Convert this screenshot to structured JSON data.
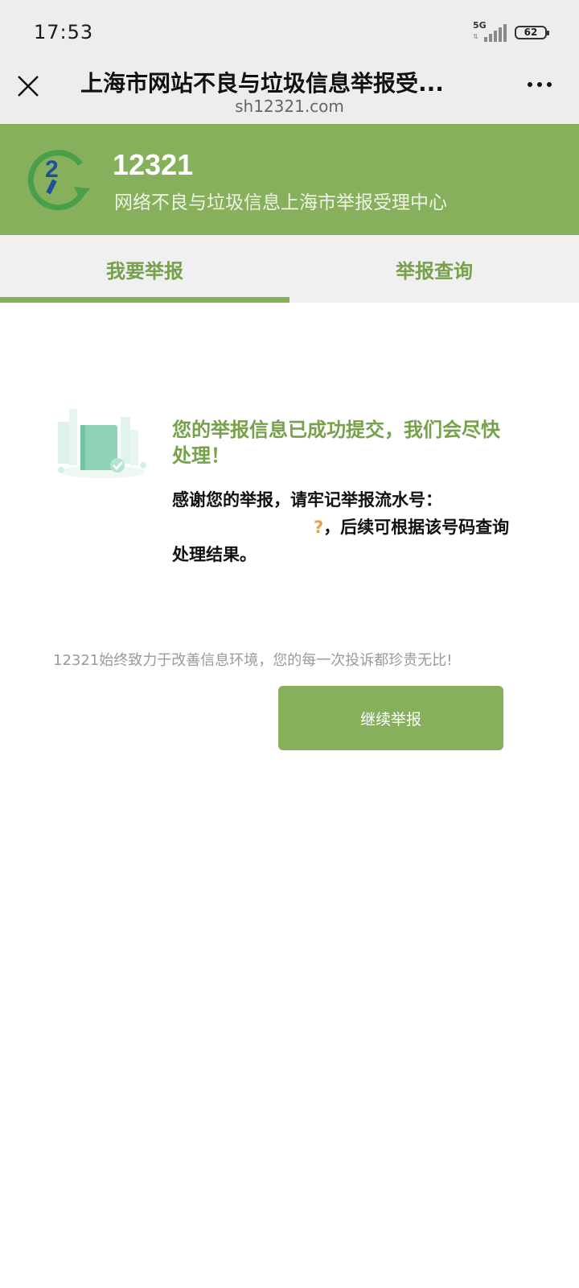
{
  "status_bar": {
    "time": "17:53",
    "network": "5G",
    "battery": "62"
  },
  "header": {
    "title": "上海市网站不良与垃圾信息举报受...",
    "url": "sh12321.com"
  },
  "banner": {
    "number": "12321",
    "subtitle": "网络不良与垃圾信息上海市举报受理中心"
  },
  "tabs": [
    {
      "label": "我要举报",
      "active": true
    },
    {
      "label": "举报查询",
      "active": false
    }
  ],
  "result": {
    "title": "您的举报信息已成功提交，我们会尽快处理！",
    "message_prefix": "感谢您的举报，请牢记举报流水号：",
    "serial_visible": "?",
    "message_suffix": "，后续可根据该号码查询处理结果。"
  },
  "footer_note": "12321始终致力于改善信息环境，您的每一次投诉都珍贵无比!",
  "continue_button": "继续举报",
  "colors": {
    "brand_green": "#86b05b",
    "text_green": "#76a14a",
    "header_bg": "#ededed"
  }
}
